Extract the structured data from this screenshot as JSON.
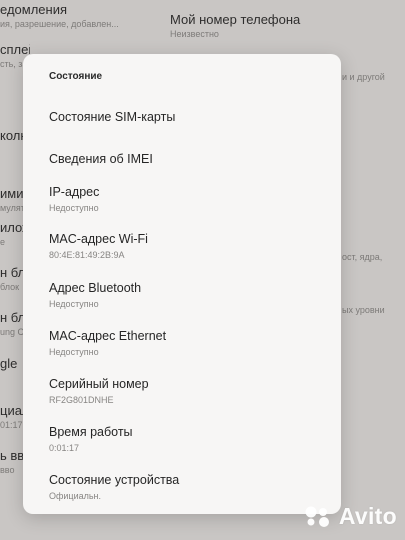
{
  "background": {
    "top_left": {
      "title": "едомления",
      "sub": "ия, разрешение, добавлен..."
    },
    "top_right": {
      "title": "Мой номер телефона",
      "sub": "Неизвестно"
    },
    "left_fragments": [
      {
        "title": "сплей",
        "sub": "сть, заставка..."
      },
      {
        "title": "колни",
        "sub": ""
      },
      {
        "title": "имиза",
        "sub": "мулятор"
      },
      {
        "title": "иложе",
        "sub": "е"
      },
      {
        "title": "н бл",
        "sub": "блок"
      },
      {
        "title": "н бл",
        "sub": "ung Cl"
      },
      {
        "title": "gle",
        "sub": ""
      },
      {
        "title": "циал",
        "sub": "01:17"
      },
      {
        "title": "ь вво",
        "sub": "вво"
      }
    ],
    "right_fragments": [
      "и и другой",
      "ост, ядра,",
      "ых уровни"
    ]
  },
  "dialog": {
    "title": "Состояние",
    "items": [
      {
        "title": "Состояние SIM-карты",
        "sub": ""
      },
      {
        "title": "Сведения об IMEI",
        "sub": ""
      },
      {
        "title": "IP-адрес",
        "sub": "Недоступно"
      },
      {
        "title": "MAC-адрес Wi-Fi",
        "sub": "80:4E:81:49:2B:9A"
      },
      {
        "title": "Адрес Bluetooth",
        "sub": "Недоступно"
      },
      {
        "title": "MAC-адрес Ethernet",
        "sub": "Недоступно"
      },
      {
        "title": "Серийный номер",
        "sub": "RF2G801DNHE"
      },
      {
        "title": "Время работы",
        "sub": "0:01:17"
      },
      {
        "title": "Состояние устройства",
        "sub": "Официальн."
      }
    ]
  },
  "watermark": {
    "text": "Avito"
  }
}
